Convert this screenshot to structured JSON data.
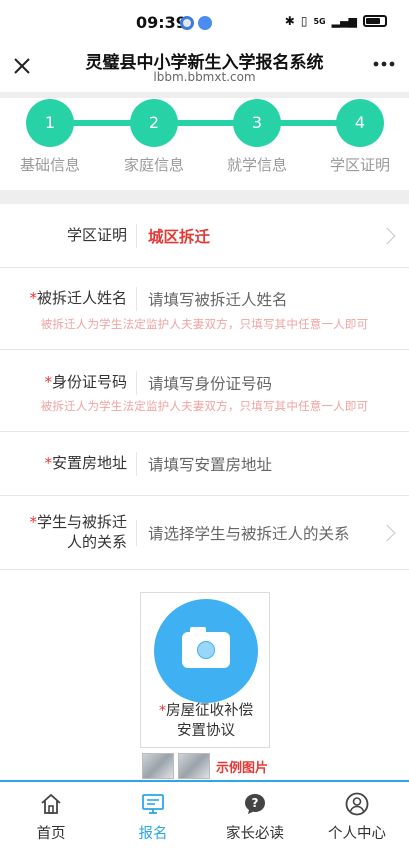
{
  "status_bar": {
    "time": "09:39",
    "network": "5G"
  },
  "header": {
    "title": "灵璧县中小学新生入学报名系统",
    "url": "lbbm.bbmxt.com",
    "close_icon": "close-icon",
    "more_icon": "more-icon"
  },
  "stepper": {
    "accent_color": "#27d3a6",
    "steps": [
      {
        "number": "1",
        "label": "基础信息"
      },
      {
        "number": "2",
        "label": "家庭信息"
      },
      {
        "number": "3",
        "label": "就学信息"
      },
      {
        "number": "4",
        "label": "学区证明"
      }
    ]
  },
  "form": {
    "district_proof": {
      "label": "学区证明",
      "value": "城区拆迁"
    },
    "demolition_name": {
      "required_mark": "*",
      "label": "被拆迁人姓名",
      "placeholder": "请填写被拆迁人姓名",
      "hint": "被拆迁人为学生法定监护人夫妻双方，只填写其中任意一人即可"
    },
    "id_number": {
      "required_mark": "*",
      "label": "身份证号码",
      "placeholder": "请填写身份证号码",
      "hint": "被拆迁人为学生法定监护人夫妻双方，只填写其中任意一人即可"
    },
    "resettlement_address": {
      "required_mark": "*",
      "label": "安置房地址",
      "placeholder": "请填写安置房地址"
    },
    "relationship": {
      "required_mark": "*",
      "label_line1": "学生与被拆迁",
      "label_line2": "人的关系",
      "placeholder": "请选择学生与被拆迁人的关系"
    }
  },
  "upload": {
    "required_mark": "*",
    "label_line1": "房屋征收补偿",
    "label_line2": "安置协议",
    "icon": "camera-icon",
    "samples_label": "示例图片"
  },
  "bottom_nav": {
    "accent_color": "#2aa8e8",
    "items": [
      {
        "label": "首页",
        "icon": "home-icon",
        "active": false
      },
      {
        "label": "报名",
        "icon": "monitor-icon",
        "active": true
      },
      {
        "label": "家长必读",
        "icon": "question-icon",
        "active": false
      },
      {
        "label": "个人中心",
        "icon": "user-icon",
        "active": false
      }
    ]
  }
}
